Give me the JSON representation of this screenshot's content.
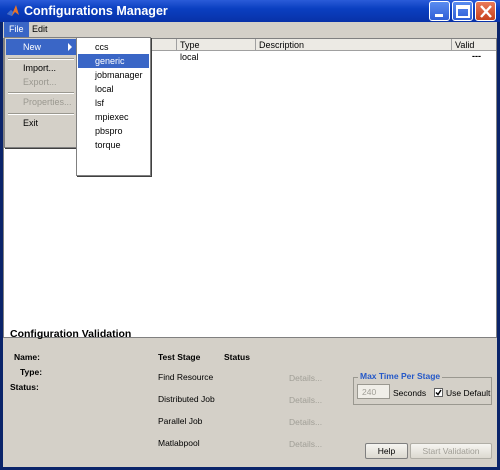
{
  "window": {
    "title": "Configurations Manager"
  },
  "menubar": {
    "file": "File",
    "edit": "Edit"
  },
  "file_menu": {
    "items": [
      {
        "label": "New",
        "state": "active",
        "has_submenu": true
      },
      {
        "label": "Import...",
        "state": "enabled"
      },
      {
        "label": "Export...",
        "state": "disabled"
      },
      {
        "label": "Properties...",
        "state": "disabled"
      },
      {
        "label": "Exit",
        "state": "enabled"
      }
    ]
  },
  "new_submenu": {
    "items": [
      "ccs",
      "generic",
      "jobmanager",
      "local",
      "lsf",
      "mpiexec",
      "pbspro",
      "torque"
    ],
    "selected": "generic"
  },
  "table": {
    "columns": [
      "Type",
      "Description",
      "Valid"
    ],
    "rows": [
      {
        "type": "local",
        "description": "",
        "valid": "---"
      }
    ]
  },
  "validation": {
    "title": "Configuration Validation",
    "labels": {
      "name": "Name:",
      "type": "Type:",
      "status": "Status:"
    },
    "headers": {
      "test_stage": "Test Stage",
      "status": "Status"
    },
    "stages": [
      {
        "name": "Find Resource",
        "details": "Details..."
      },
      {
        "name": "Distributed Job",
        "details": "Details..."
      },
      {
        "name": "Parallel Job",
        "details": "Details..."
      },
      {
        "name": "Matlabpool",
        "details": "Details..."
      }
    ],
    "max_time": {
      "title": "Max Time Per Stage",
      "value": "240",
      "unit": "Seconds",
      "use_default_label": "Use Default",
      "use_default_checked": true
    },
    "buttons": {
      "help": "Help",
      "start": "Start Validation"
    }
  },
  "colors": {
    "titlebar": "#0a3fc0",
    "selection": "#3a66c6",
    "group_title": "#2458c8"
  }
}
